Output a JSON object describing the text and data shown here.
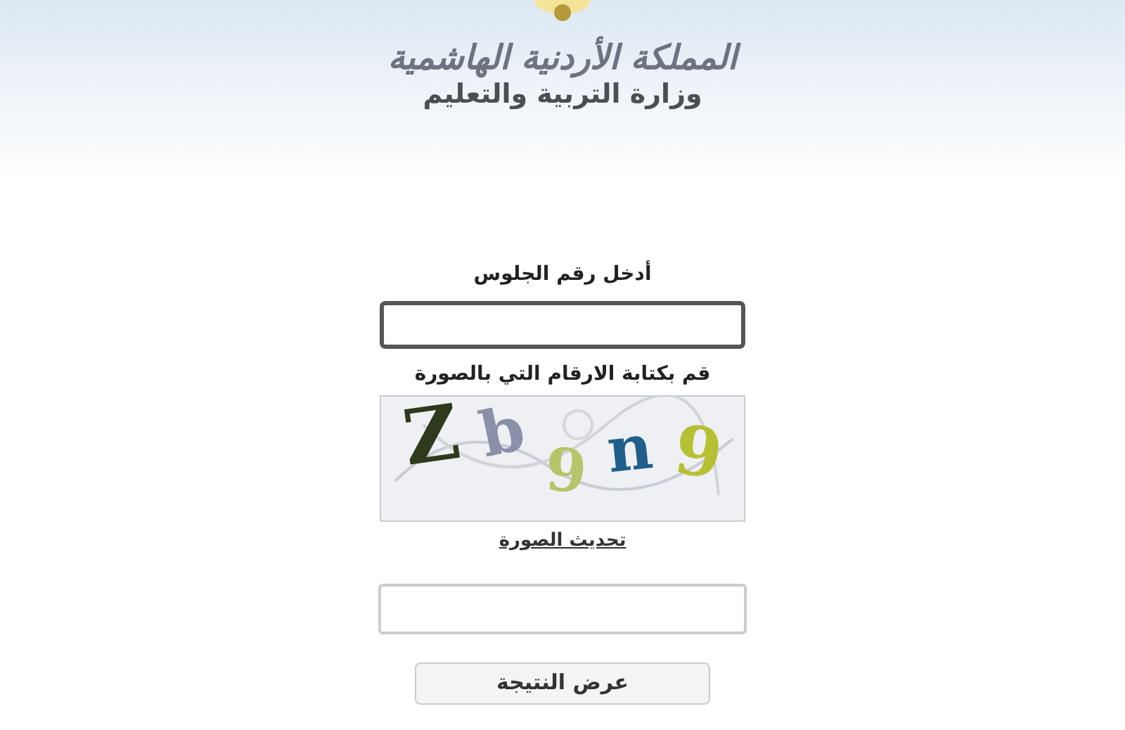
{
  "header": {
    "title": "المملكة الأردنية الهاشمية",
    "subtitle": "وزارة التربية والتعليم"
  },
  "seat_number": {
    "label": "أدخل رقم الجلوس"
  },
  "captcha": {
    "label": "قم بكتابة الارقام التي بالصورة",
    "characters": [
      {
        "text": "Z",
        "color": "#2f3a1c"
      },
      {
        "text": "b",
        "color": "#8a90a8"
      },
      {
        "text": "9",
        "color": "#b8c46a"
      },
      {
        "text": "n",
        "color": "#1f5f8a"
      },
      {
        "text": "9",
        "color": "#b7c034"
      }
    ],
    "refresh_link": "تحديث الصورة"
  },
  "submit_button": "عرض النتيجة"
}
